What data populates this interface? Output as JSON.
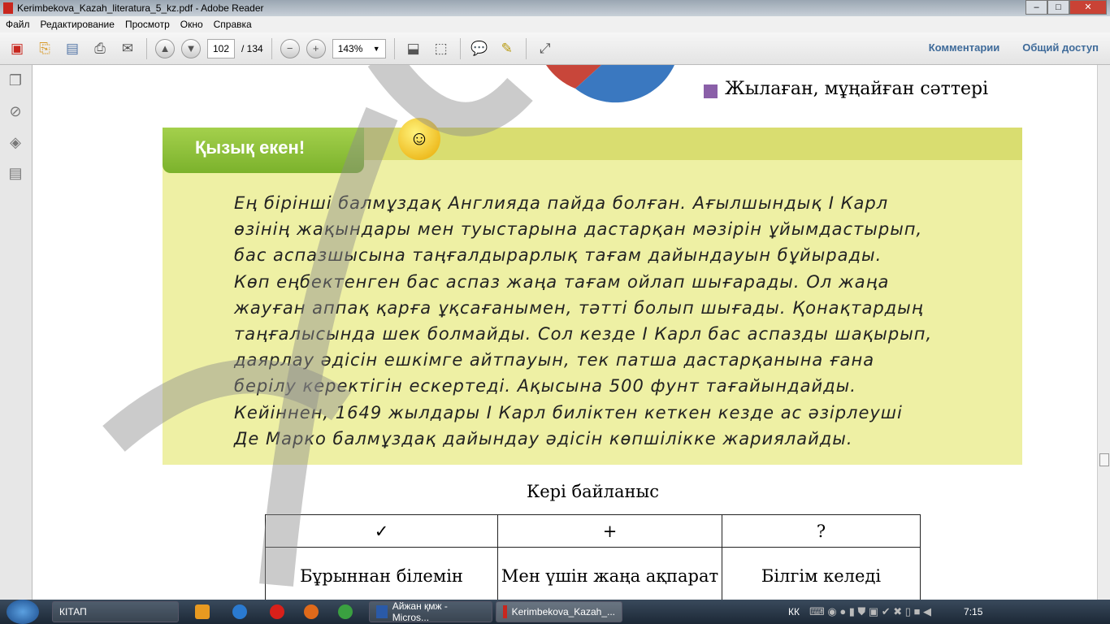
{
  "window": {
    "title": "Kerimbekova_Kazah_literatura_5_kz.pdf - Adobe Reader",
    "min": "–",
    "max": "□",
    "close": "✕"
  },
  "menu": [
    "Файл",
    "Редактирование",
    "Просмотр",
    "Окно",
    "Справка"
  ],
  "toolbar": {
    "page": "102",
    "total": "/ 134",
    "zoom": "143%",
    "comments": "Комментарии",
    "share": "Общий доступ"
  },
  "page": {
    "legend_item": "Жылаған, мұңайған сәттері",
    "legend_color": "#8a5fa8",
    "box_title": "Қызық екен!",
    "lines": [
      "Ең бірінші балмұздақ Англияда пайда болған. Ағылшындық І Карл",
      "өзінің жақындары мен туыстарына дастарқан мәзірін ұйымдастырып,",
      "бас аспазшысына таңғалдырарлық тағам дайындауын бұйырады.",
      "Көп еңбектенген бас аспаз жаңа тағам ойлап шығарады. Ол жаңа",
      "жауған аппақ қарға ұқсағанымен, тәтті болып шығады. Қонақтардың",
      "таңғалысында шек болмайды. Сол кезде І Карл бас аспазды шақырып,",
      "даярлау әдісін ешкімге айтпауын, тек патша дастарқанына ғана",
      "берілу керектігін ескертеді. Ақысына 500 фунт тағайындайды.",
      "Кейіннен, 1649 жылдары І Карл биліктен кеткен кезде ас әзірлеуші",
      "Де Марко балмұздақ дайындау әдісін көпшілікке жариялайды."
    ],
    "table_title": "Кері байланыс",
    "table_head": [
      "✓",
      "+",
      "?"
    ],
    "table_row": [
      "Бұрыннан білемін",
      "Мен үшін жаңа ақпарат",
      "Білгім келеді"
    ]
  },
  "taskbar": {
    "folder": "КІТАП",
    "word": "Айжан қмж - Micros...",
    "reader": "Kerimbekova_Kazah_...",
    "lang": "КК",
    "time": "7:15"
  }
}
